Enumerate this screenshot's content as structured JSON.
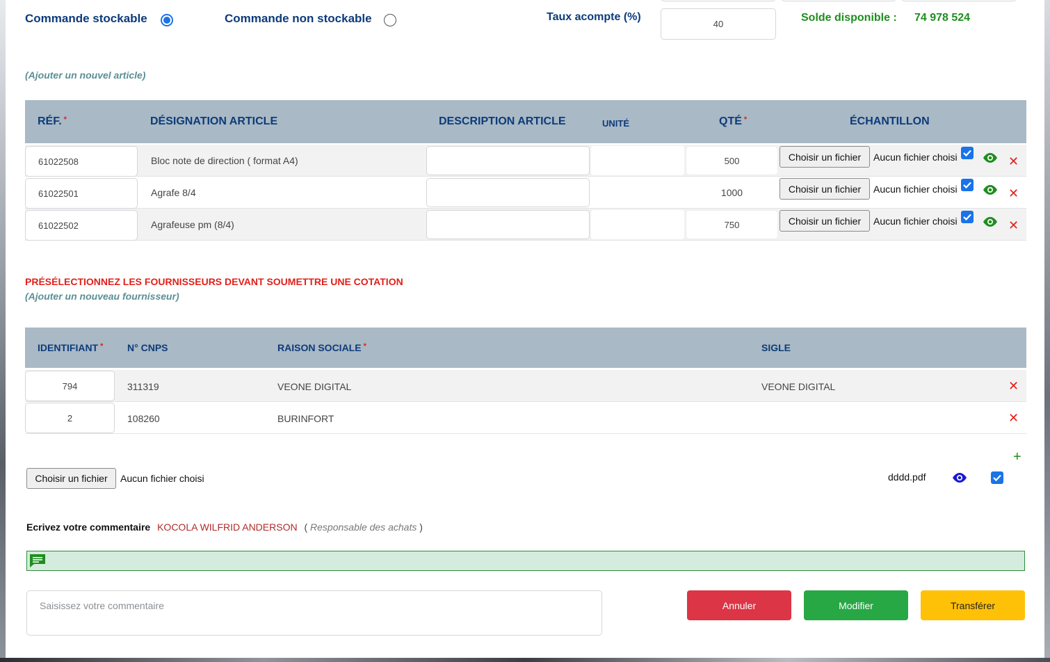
{
  "order_type": {
    "stockable_label": "Commande stockable",
    "non_stockable_label": "Commande non stockable",
    "selected": "stockable"
  },
  "deposit": {
    "label": "Taux acompte (%)",
    "value": "40"
  },
  "balance": {
    "label": "Solde disponible :",
    "value": "74 978 524"
  },
  "articles": {
    "add_link": "(Ajouter un nouvel article)",
    "headers": {
      "ref": "RÉF.",
      "designation": "DÉSIGNATION ARTICLE",
      "description": "DESCRIPTION ARTICLE",
      "unit": "UNITÉ",
      "qty": "QTÉ",
      "sample": "ÉCHANTILLON"
    },
    "required_mark": "*",
    "rows": [
      {
        "ref": "61022508",
        "designation": "Bloc note de direction ( format A4)",
        "description": "",
        "unit": "",
        "qty": "500",
        "file_button": "Choisir un fichier",
        "file_status": "Aucun fichier choisi"
      },
      {
        "ref": "61022501",
        "designation": "Agrafe 8/4",
        "description": "",
        "unit": "",
        "qty": "1000",
        "file_button": "Choisir un fichier",
        "file_status": "Aucun fichier choisi"
      },
      {
        "ref": "61022502",
        "designation": "Agrafeuse pm (8/4)",
        "description": "",
        "unit": "",
        "qty": "750",
        "file_button": "Choisir un fichier",
        "file_status": "Aucun fichier choisi"
      }
    ]
  },
  "suppliers": {
    "title": "PRÉSÉLECTIONNEZ LES FOURNISSEURS DEVANT SOUMETTRE UNE COTATION",
    "add_link": "(Ajouter un nouveau fournisseur)",
    "headers": {
      "id": "IDENTIFIANT",
      "cnps": "N° CNPS",
      "company": "RAISON SOCIALE",
      "acronym": "SIGLE"
    },
    "rows": [
      {
        "id": "794",
        "cnps": "311319",
        "company": "VEONE DIGITAL",
        "acronym": "VEONE DIGITAL"
      },
      {
        "id": "2",
        "cnps": "108260",
        "company": "BURINFORT",
        "acronym": ""
      }
    ]
  },
  "attachment": {
    "file_button": "Choisir un fichier",
    "file_status": "Aucun fichier choisi",
    "existing_file": "dddd.pdf",
    "add_symbol": "+"
  },
  "comment": {
    "label": "Ecrivez votre commentaire",
    "author": "KOCOLA WILFRID ANDERSON",
    "role": "Responsable des achats",
    "paren_open": "(",
    "paren_close": ")",
    "placeholder": "Saisissez votre commentaire"
  },
  "actions": {
    "cancel": "Annuler",
    "modify": "Modifier",
    "transfer": "Transférer"
  },
  "colors": {
    "primary_blue": "#0d3b7a",
    "balance_green": "#1e8e1e",
    "header_bg": "#a9b9c5",
    "danger": "#dc3545",
    "success": "#28a745",
    "warning": "#ffc107",
    "comment_bar": "#d4ecdd"
  }
}
